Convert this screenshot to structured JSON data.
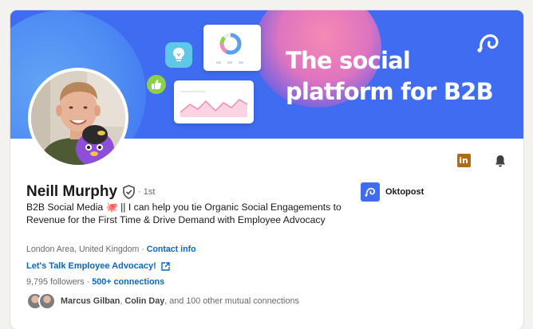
{
  "banner": {
    "headline": "The social platform for B2B",
    "colors": {
      "background": "#3f6cf1",
      "accent_pink": "#f58ab3",
      "accent_green": "#8bd14a",
      "accent_cyan": "#5fc8e8"
    }
  },
  "actions": {
    "linkedin_icon": "linkedin-icon",
    "bell_icon": "bell-icon"
  },
  "profile": {
    "name": "Neill Murphy",
    "verified_icon": "shield-check-icon",
    "degree": "· 1st",
    "headline": "B2B Social Media 🐙 || I can help you tie Organic Social Engagements to Revenue for the First Time & Drive Demand with Employee Advocacy",
    "location": "London Area, United Kingdom",
    "meta_separator": " · ",
    "contact_info": "Contact info",
    "website": "Let's Talk Employee Advocacy!",
    "followers": "9,795 followers",
    "stats_separator": " · ",
    "connections": "500+ connections",
    "mutual": {
      "name1": "Marcus Gilban",
      "name2": "Colin Day",
      "rest": ", and 100 other mutual connections"
    }
  },
  "company": {
    "name": "Oktopost"
  },
  "colors": {
    "link": "#0a66c2",
    "linkedin_orange": "#b06c14"
  }
}
